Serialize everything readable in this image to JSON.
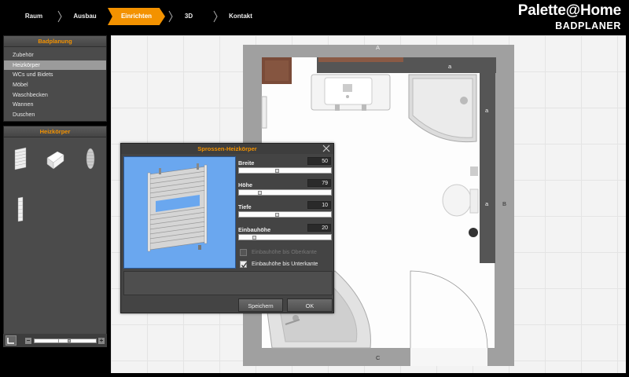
{
  "nav": {
    "steps": [
      "Raum",
      "Ausbau",
      "Einrichten",
      "3D",
      "Kontakt"
    ],
    "active": "Einrichten"
  },
  "brand": {
    "logo": "Palette@Home",
    "subtitle": "BADPLANER"
  },
  "sidebar": {
    "planning_title": "Badplanung",
    "items": [
      "Zubehör",
      "Heizkörper",
      "WCs und Bidets",
      "Möbel",
      "Waschbecken",
      "Wannen",
      "Duschen"
    ],
    "selected": "Heizkörper",
    "catalog_title": "Heizkörper",
    "catalog_icons": [
      "towel-radiator-icon",
      "panel-radiator-icon",
      "oval-radiator-icon",
      "slim-radiator-icon"
    ]
  },
  "plan": {
    "wall_labels": {
      "top": "A",
      "right_outer": "B",
      "bottom": "C",
      "seg_top": "a",
      "seg_right1": "a",
      "seg_right2": "a"
    }
  },
  "dialog": {
    "title": "Sprossen-Heizkörper",
    "params": [
      {
        "label": "Breite",
        "value": "50",
        "level": 0.42
      },
      {
        "label": "Höhe",
        "value": "79",
        "level": 0.22
      },
      {
        "label": "Tiefe",
        "value": "10",
        "level": 0.42
      },
      {
        "label": "Einbauhöhe",
        "value": "20",
        "level": 0.15
      }
    ],
    "options": [
      {
        "label": "Einbauhöhe bis Oberkante",
        "checked": false,
        "enabled": false
      },
      {
        "label": "Einbauhöhe bis Unterkante",
        "checked": true,
        "enabled": true
      }
    ],
    "save_label": "Speichern",
    "ok_label": "OK"
  },
  "colors": {
    "accent": "#f39200",
    "panel": "#4b4b4b",
    "wall": "#9a9a9a",
    "preview_bg": "#6aa7ef"
  }
}
